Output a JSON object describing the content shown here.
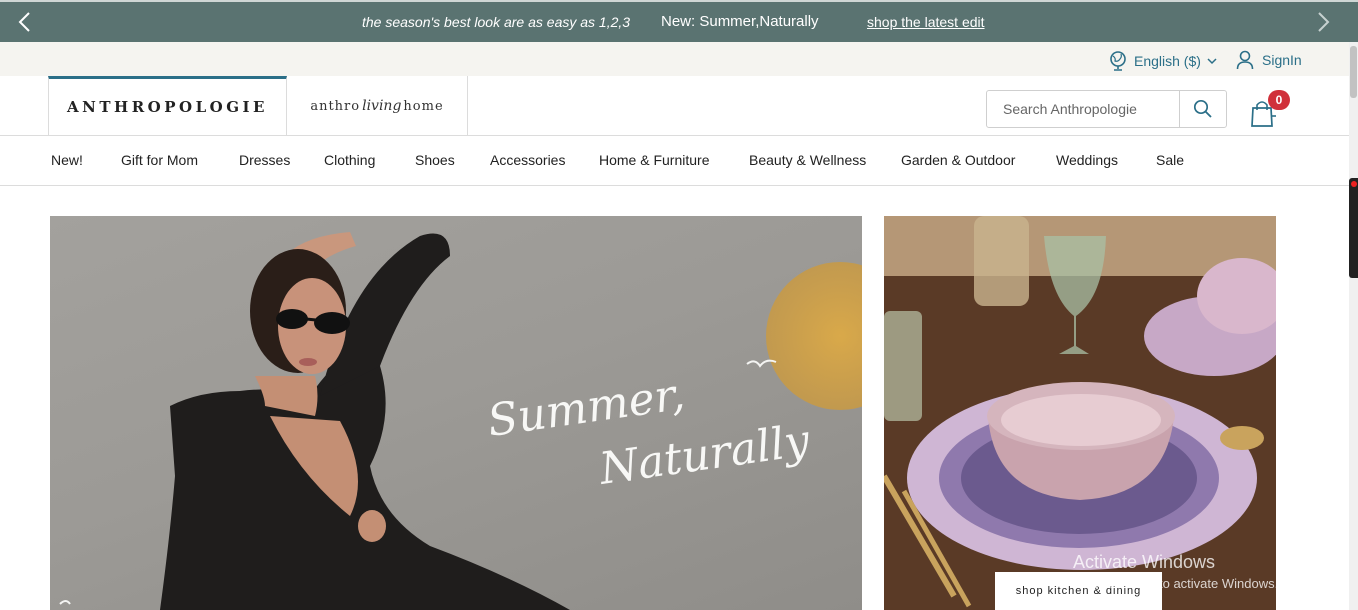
{
  "promo": {
    "tagline": "the season's best look are as easy as 1,2,3",
    "headline": "New: Summer,Naturally",
    "link": "shop the latest edit"
  },
  "utility": {
    "language": "English ($)",
    "signin": "SignIn"
  },
  "brands": {
    "main": "ANTHROPOLOGIE",
    "living_prefix": "anthro",
    "living_script": "living",
    "living_suffix": "home"
  },
  "search": {
    "placeholder": "Search Anthropologie"
  },
  "cart": {
    "count": "0"
  },
  "nav": {
    "items": [
      "New!",
      "Gift for Mom",
      "Dresses",
      "Clothing",
      "Shoes",
      "Accessories",
      "Home & Furniture",
      "Beauty & Wellness",
      "Garden & Outdoor",
      "Weddings",
      "Sale"
    ]
  },
  "hero": {
    "script_line1": "Summer,",
    "script_line2": "Naturally"
  },
  "side_promo": {
    "cta": "shop kitchen & dining"
  },
  "os_watermark": {
    "title": "Activate Windows",
    "subtitle": "Go to Settings to activate Windows."
  },
  "colors": {
    "promo_bg": "#5a7371",
    "accent": "#2b6f88",
    "badge": "#d0303a",
    "utility_bg": "#f5f4f0"
  }
}
